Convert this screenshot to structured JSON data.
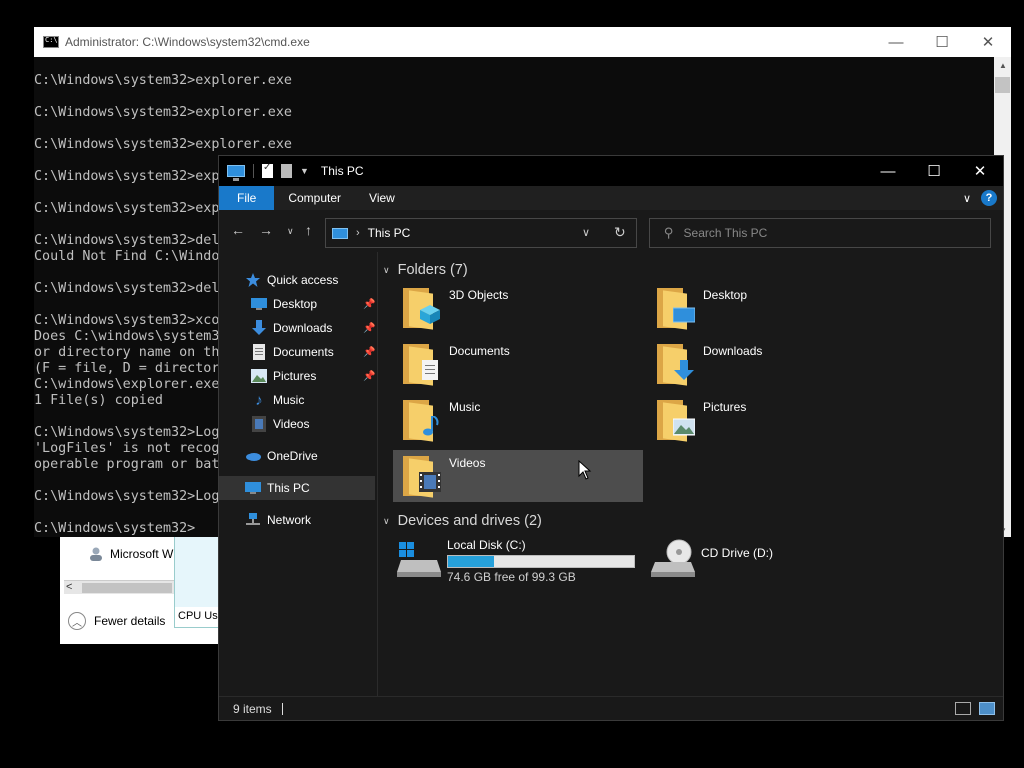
{
  "task_manager": {
    "process_label": "Microsoft W",
    "graph_label": "CPU Usa",
    "fewer_details": "Fewer details"
  },
  "cmd": {
    "title": "Administrator: C:\\Windows\\system32\\cmd.exe",
    "lines": [
      "C:\\Windows\\system32>explorer.exe",
      "",
      "C:\\Windows\\system32>explorer.exe",
      "",
      "C:\\Windows\\system32>explorer.exe",
      "",
      "C:\\Windows\\system32>exp",
      "",
      "C:\\Windows\\system32>exp",
      "",
      "C:\\Windows\\system32>del",
      "Could Not Find C:\\Windo",
      "",
      "C:\\Windows\\system32>del",
      "",
      "C:\\Windows\\system32>xco",
      "Does C:\\windows\\system3",
      "or directory name on th",
      "(F = file, D = director",
      "C:\\windows\\explorer.exe",
      "1 File(s) copied",
      "",
      "C:\\Windows\\system32>Log",
      "'LogFiles' is not recog",
      "operable program or bat",
      "",
      "C:\\Windows\\system32>Log",
      "",
      "C:\\Windows\\system32>"
    ]
  },
  "explorer": {
    "title": "This PC",
    "ribbon_tabs": [
      "File",
      "Computer",
      "View"
    ],
    "address": "This PC",
    "search_placeholder": "Search This PC",
    "nav": {
      "quick_access": "Quick access",
      "desktop": "Desktop",
      "downloads": "Downloads",
      "documents": "Documents",
      "pictures": "Pictures",
      "music": "Music",
      "videos": "Videos",
      "onedrive": "OneDrive",
      "this_pc": "This PC",
      "network": "Network"
    },
    "folders_header": "Folders (7)",
    "folders": [
      "3D Objects",
      "Desktop",
      "Documents",
      "Downloads",
      "Music",
      "Pictures",
      "Videos"
    ],
    "devices_header": "Devices and drives (2)",
    "drives": [
      {
        "name": "Local Disk (C:)",
        "free": "74.6 GB free of 99.3 GB",
        "used_fraction": 0.249
      },
      {
        "name": "CD Drive (D:)"
      }
    ],
    "status": "9 items",
    "colors": {
      "accent": "#1979ca",
      "background": "#191919",
      "drive_bar": "#26a0da"
    }
  }
}
